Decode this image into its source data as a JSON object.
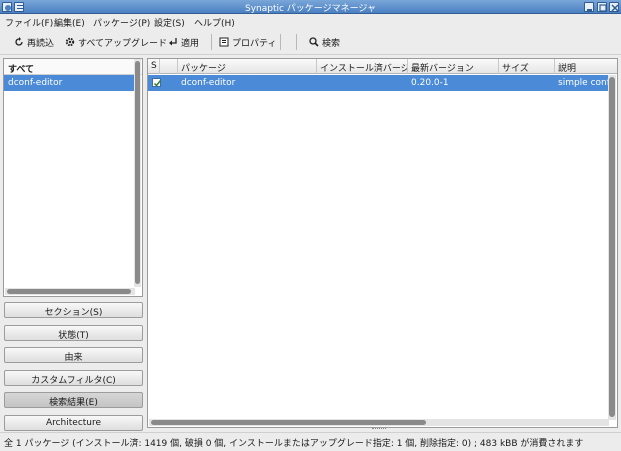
{
  "window": {
    "title": "Synaptic パッケージマネージャ",
    "controls": [
      "minimize-icon",
      "maximize-icon",
      "close-icon"
    ]
  },
  "menu": [
    {
      "label": "ファイル(F)"
    },
    {
      "label": "編集(E)"
    },
    {
      "label": "パッケージ(P)"
    },
    {
      "label": "設定(S)"
    },
    {
      "label": "ヘルプ(H)"
    }
  ],
  "toolbar": {
    "reload": "再読込",
    "upgrade_all": "すべてアップグレード",
    "apply": "適用",
    "properties": "プロパティ",
    "search": "検索"
  },
  "left_panel": {
    "header": "すべて",
    "items": [
      "dconf-editor"
    ]
  },
  "filter_buttons": [
    {
      "label": "セクション(S)",
      "active": false
    },
    {
      "label": "状態(T)",
      "active": false
    },
    {
      "label": "由来",
      "active": false
    },
    {
      "label": "カスタムフィルタ(C)",
      "active": false
    },
    {
      "label": "検索結果(E)",
      "active": true
    },
    {
      "label": "Architecture",
      "active": false
    }
  ],
  "table": {
    "columns": [
      "S",
      "パッケージ",
      "インストール済バージョン",
      "最新バージョン",
      "サイズ",
      "説明"
    ],
    "rows": [
      {
        "status_checked": true,
        "package": "dconf-editor",
        "installed": "",
        "latest": "0.20.0-1",
        "size": "",
        "description": "simple configuration storage system - graphical editor"
      }
    ]
  },
  "status": "全 1 パッケージ (インストール済: 1419 個, 破損 0 個, インストールまたはアップグレード指定: 1 個, 削除指定: 0) ; 483 kBB が消費されます",
  "colors": {
    "selection": "#4a8ad6",
    "titlebar": "#4a7fc1"
  }
}
